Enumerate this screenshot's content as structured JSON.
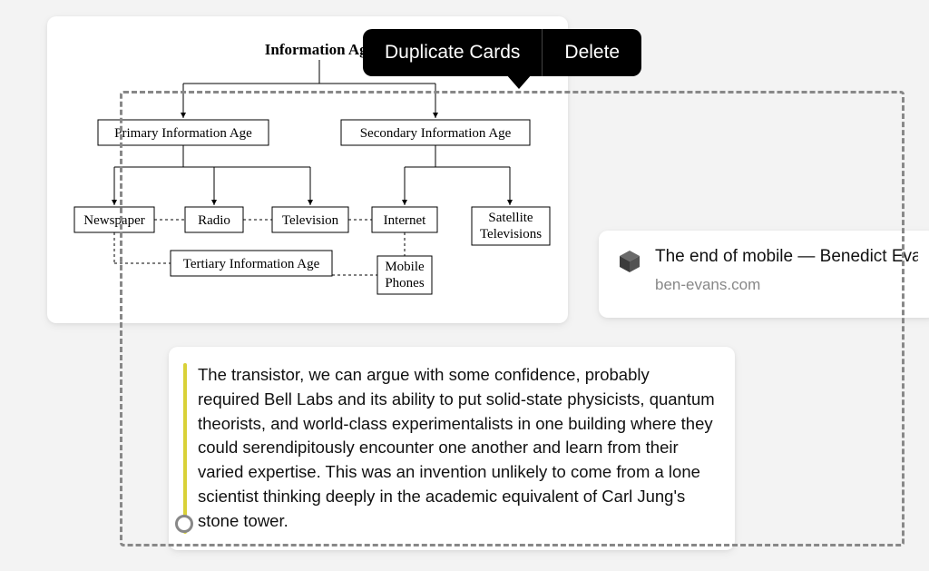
{
  "context_menu": {
    "duplicate": "Duplicate Cards",
    "delete": "Delete"
  },
  "diagram": {
    "title": "Information Age",
    "nodes": {
      "primary": "Primary Information Age",
      "secondary": "Secondary Information Age",
      "newspaper": "Newspaper",
      "radio": "Radio",
      "television": "Television",
      "internet": "Internet",
      "satellite_l1": "Satellite",
      "satellite_l2": "Televisions",
      "tertiary": "Tertiary Information Age",
      "mobile_l1": "Mobile",
      "mobile_l2": "Phones"
    }
  },
  "link_card": {
    "title": "The end of mobile — Benedict Evans",
    "domain": "ben-evans.com"
  },
  "quote_card": {
    "text": "The transistor, we can argue with some confidence, probably required Bell Labs and its ability to put solid-state physicists, quantum theorists, and world-class experimentalists in one building where they could serendipitously encounter one another and learn from their varied expertise. This was an invention unlikely to come from a lone scientist thinking deeply in the academic equivalent of Carl Jung's stone tower."
  }
}
